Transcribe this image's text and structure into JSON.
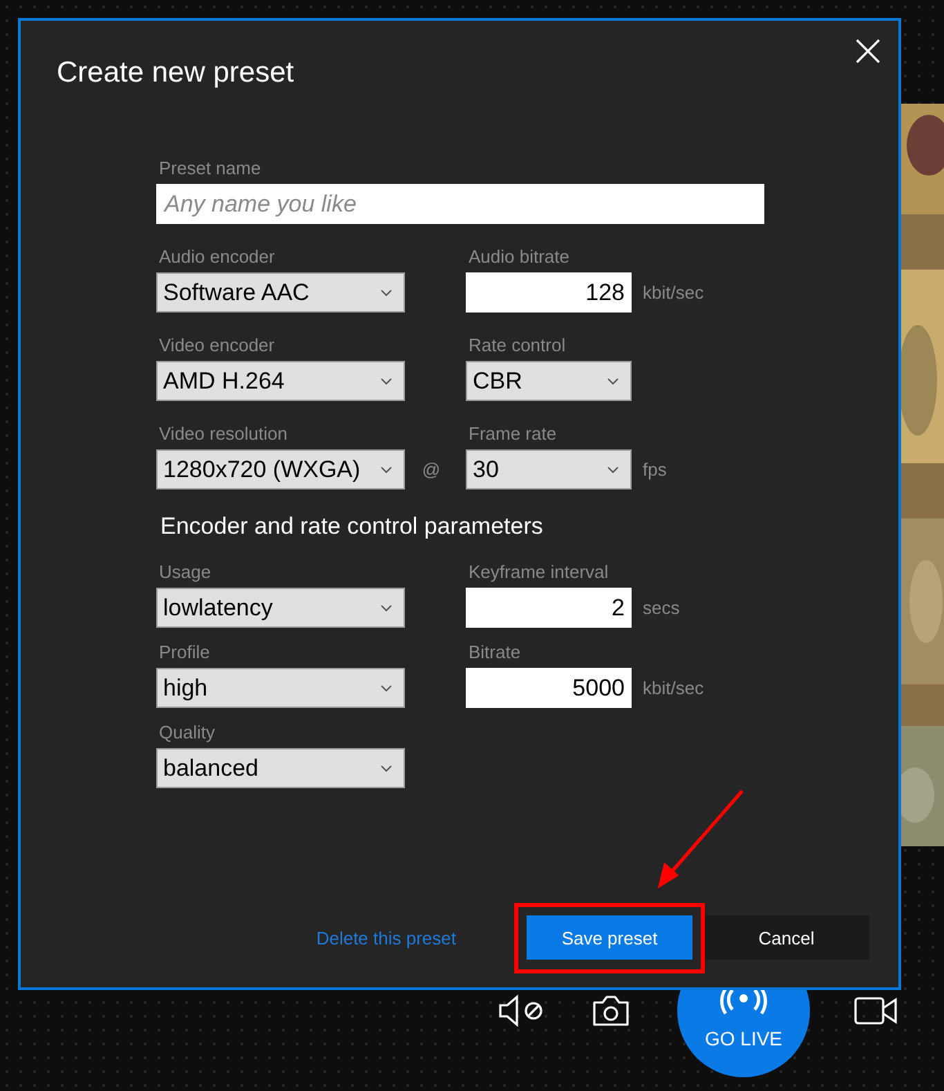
{
  "dialog": {
    "title": "Create new preset"
  },
  "preset_name": {
    "label": "Preset name",
    "placeholder": "Any name you like"
  },
  "rows": [
    {
      "fields": [
        {
          "kind": "select",
          "label": "Audio encoder",
          "value": "Software AAC"
        },
        {
          "kind": "number",
          "label": "Audio bitrate",
          "value": "128",
          "unit": "kbit/sec"
        }
      ]
    },
    {
      "fields": [
        {
          "kind": "select",
          "label": "Video encoder",
          "value": "AMD H.264"
        },
        {
          "kind": "select",
          "label": "Rate control",
          "value": "CBR"
        }
      ]
    },
    {
      "separator": "@",
      "fields": [
        {
          "kind": "select",
          "label": "Video resolution",
          "value": "1280x720 (WXGA)"
        },
        {
          "kind": "select",
          "label": "Frame rate",
          "value": "30",
          "unit": "fps"
        }
      ]
    }
  ],
  "section_title": "Encoder and rate control parameters",
  "param_rows": [
    {
      "fields": [
        {
          "kind": "select",
          "label": "Usage",
          "value": "lowlatency"
        },
        {
          "kind": "number",
          "label": "Keyframe interval",
          "value": "2",
          "unit": "secs"
        }
      ]
    },
    {
      "fields": [
        {
          "kind": "select",
          "label": "Profile",
          "value": "high"
        },
        {
          "kind": "number",
          "label": "Bitrate",
          "value": "5000",
          "unit": "kbit/sec"
        }
      ]
    },
    {
      "fields": [
        {
          "kind": "select",
          "label": "Quality",
          "value": "balanced"
        }
      ]
    }
  ],
  "footer": {
    "link": "Delete this preset",
    "primary": "Save preset",
    "primary_highlighted": true,
    "secondary": "Cancel"
  },
  "toolbar": {
    "go_live": "GO LIVE"
  }
}
